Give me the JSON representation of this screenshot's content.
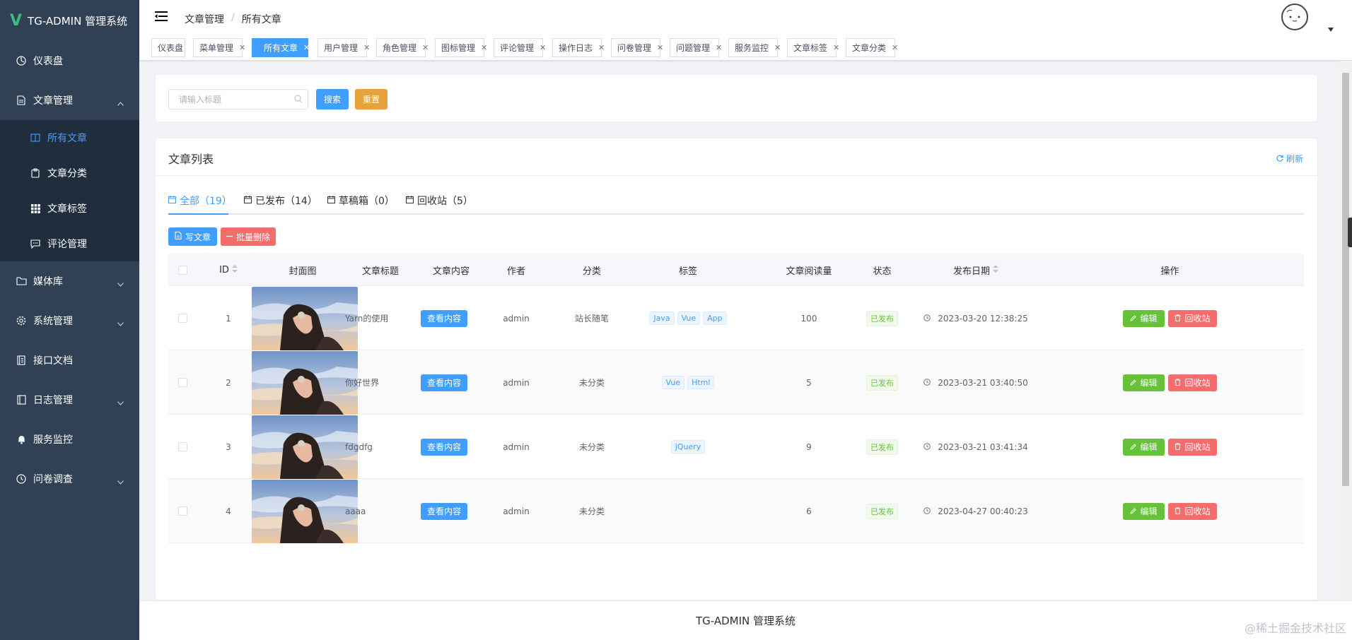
{
  "app": {
    "logo_letter": "V",
    "title": "TG-ADMIN 管理系统"
  },
  "sidebar": {
    "items": [
      {
        "label": "仪表盘",
        "icon": "dashboard-icon"
      },
      {
        "label": "文章管理",
        "icon": "document-icon",
        "expanded": true,
        "children": [
          {
            "label": "所有文章",
            "icon": "book-icon",
            "active": true
          },
          {
            "label": "文章分类",
            "icon": "clipboard-icon"
          },
          {
            "label": "文章标签",
            "icon": "grid-icon"
          },
          {
            "label": "评论管理",
            "icon": "comment-icon"
          }
        ]
      },
      {
        "label": "媒体库",
        "icon": "folder-icon"
      },
      {
        "label": "系统管理",
        "icon": "gear-icon"
      },
      {
        "label": "接口文档",
        "icon": "notebook-icon"
      },
      {
        "label": "日志管理",
        "icon": "log-icon"
      },
      {
        "label": "服务监控",
        "icon": "bell-icon"
      },
      {
        "label": "问卷调查",
        "icon": "clock-icon"
      }
    ]
  },
  "breadcrumb": {
    "parent": "文章管理",
    "separator": "/",
    "current": "所有文章"
  },
  "tags": [
    "仪表盘",
    "菜单管理",
    "所有文章",
    "用户管理",
    "角色管理",
    "图标管理",
    "评论管理",
    "操作日志",
    "问卷管理",
    "问题管理",
    "服务监控",
    "文章标签",
    "文章分类"
  ],
  "active_tag": "所有文章",
  "search": {
    "placeholder": "请输入标题",
    "search_label": "搜索",
    "reset_label": "重置"
  },
  "list": {
    "title": "文章列表",
    "refresh_label": "刷新",
    "tabs": [
      {
        "label": "全部（19）"
      },
      {
        "label": "已发布（14）"
      },
      {
        "label": "草稿箱（0）"
      },
      {
        "label": "回收站（5）"
      }
    ],
    "write_label": "写文章",
    "batch_delete_label": "批量删除",
    "columns": [
      "ID",
      "封面图",
      "文章标题",
      "文章内容",
      "作者",
      "分类",
      "标签",
      "文章阅读量",
      "状态",
      "发布日期",
      "操作"
    ],
    "view_label": "查看内容",
    "edit_label": "编辑",
    "recycle_label": "回收站",
    "rows": [
      {
        "id": "1",
        "title": "Yarn的使用",
        "author": "admin",
        "category": "站长随笔",
        "tags": [
          "Java",
          "Vue",
          "App"
        ],
        "views": "100",
        "status": "已发布",
        "date": "2023-03-20 12:38:25"
      },
      {
        "id": "2",
        "title": "你好世界",
        "author": "admin",
        "category": "未分类",
        "tags": [
          "Vue",
          "Html"
        ],
        "views": "5",
        "status": "已发布",
        "date": "2023-03-21 03:40:50"
      },
      {
        "id": "3",
        "title": "fdgdfg",
        "author": "admin",
        "category": "未分类",
        "tags": [
          "jQuery"
        ],
        "views": "9",
        "status": "已发布",
        "date": "2023-03-21 03:41:34"
      },
      {
        "id": "4",
        "title": "aaaa",
        "author": "admin",
        "category": "未分类",
        "tags": [],
        "views": "6",
        "status": "已发布",
        "date": "2023-04-27 00:40:23"
      }
    ]
  },
  "footer": {
    "text": "TG-ADMIN 管理系统"
  },
  "watermark": "@稀土掘金技术社区",
  "colors": {
    "sidebar": "#304156",
    "submenu": "#1f2d3d",
    "primary": "#409eff",
    "success": "#67c23a",
    "danger": "#f56c6c",
    "warning": "#e6a23c"
  }
}
